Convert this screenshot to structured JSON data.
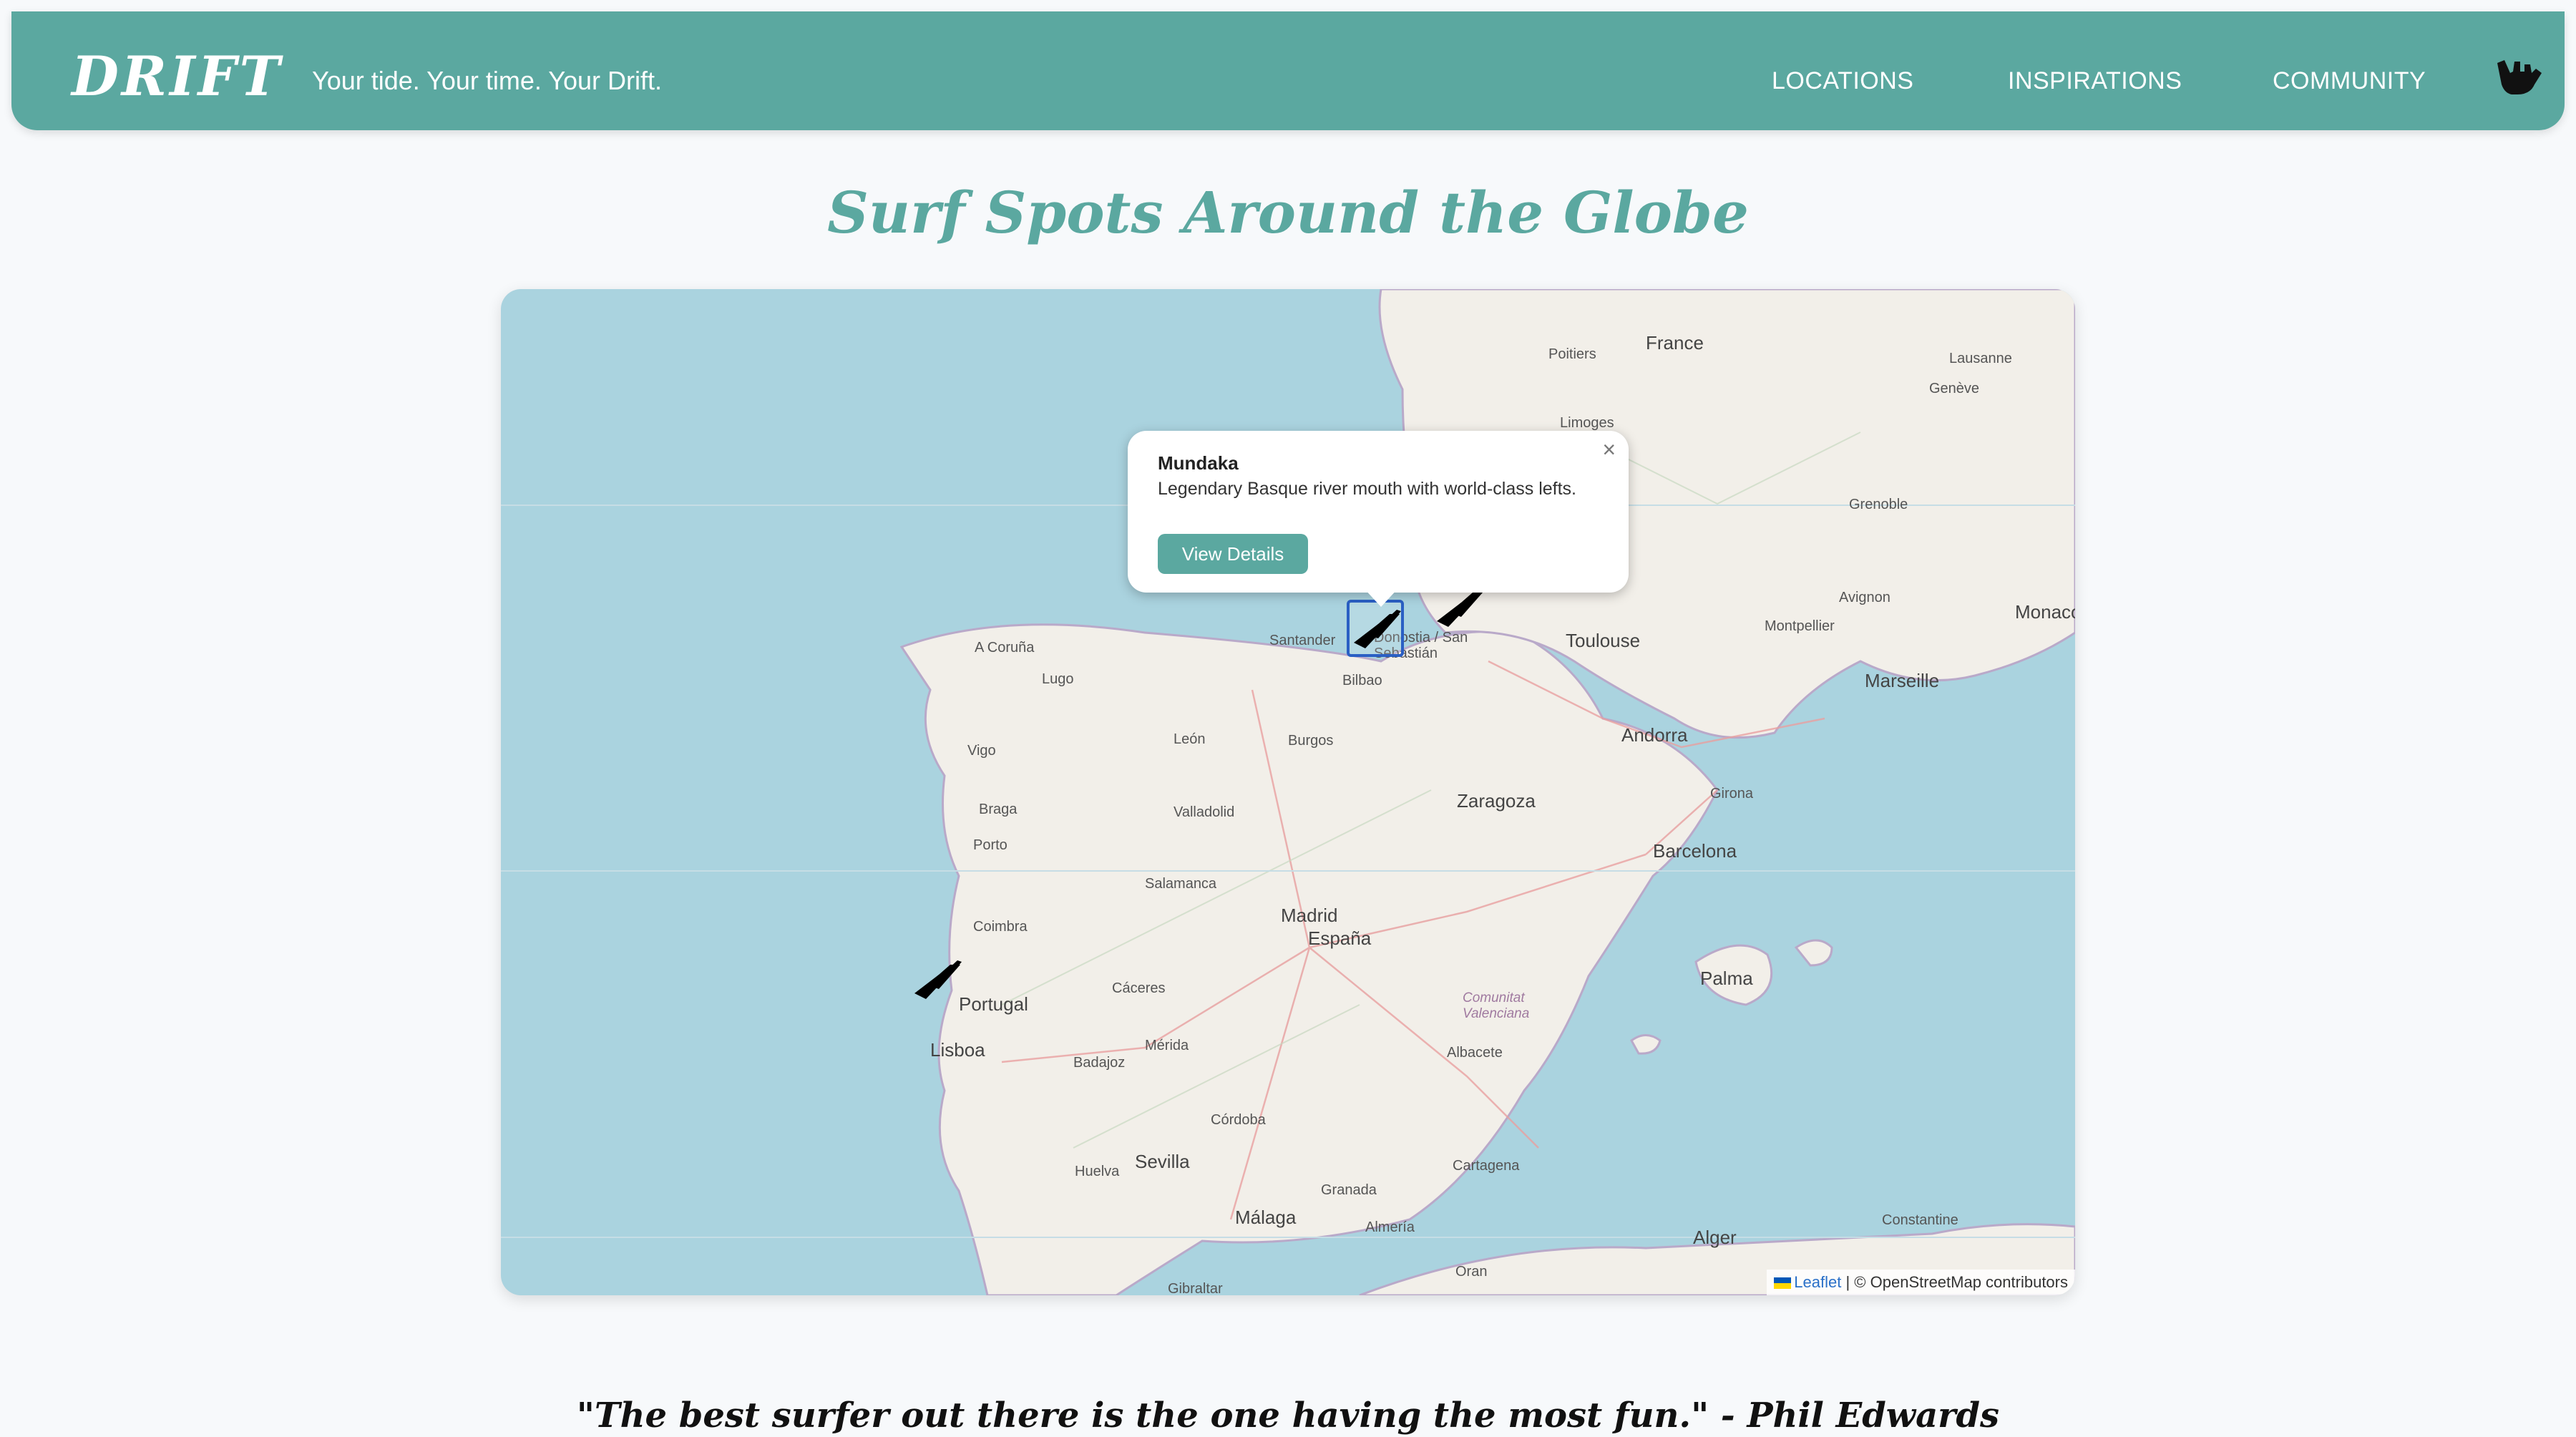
{
  "header": {
    "logo": "DRIFT",
    "tagline": "Your tide. Your time. Your Drift.",
    "nav": [
      "LOCATIONS",
      "INSPIRATIONS",
      "COMMUNITY"
    ],
    "icon": "shaka-hand-icon"
  },
  "page_title": "Surf Spots Around the Globe",
  "map": {
    "labels": {
      "country_france": "France",
      "country_spain": "España",
      "country_portugal": "Portugal",
      "madrid": "Madrid",
      "lisboa": "Lisboa",
      "toulouse": "Toulouse",
      "zaragoza": "Zaragoza",
      "barcelona": "Barcelona",
      "sevilla": "Sevilla",
      "malaga": "Málaga",
      "marseille": "Marseille",
      "andorra": "Andorra",
      "palma": "Palma",
      "bilbao": "Bilbao",
      "santander": "Santander",
      "donostia": "Donostia / San Sebastián",
      "a_coruna": "A Coruña",
      "porto": "Porto",
      "coimbra": "Coimbra",
      "valladolid": "Valladolid",
      "salamanca": "Salamanca",
      "granada": "Granada",
      "cordoba": "Córdoba",
      "valencia_region": "Comunitat Valenciana",
      "alger": "Alger",
      "oran": "Oran",
      "gibraltar": "Gibraltar",
      "montpellier": "Montpellier",
      "limoges": "Limoges",
      "poitiers": "Poitiers",
      "lausanne": "Lausanne",
      "geneve": "Genève",
      "grenoble": "Grenoble",
      "avignon": "Avignon",
      "monaco": "Monaco",
      "leon": "León",
      "burgos": "Burgos",
      "caceres": "Cáceres",
      "albacete": "Albacete",
      "cartagena": "Cartagena",
      "almeria": "Almería",
      "huelva": "Huelva",
      "badajoz": "Badajoz",
      "merida": "Mérida",
      "vigo": "Vigo",
      "braga": "Braga",
      "lugo": "Lugo",
      "girona": "Girona",
      "constantine": "Constantine"
    },
    "popup": {
      "title": "Mundaka",
      "description": "Legendary Basque river mouth with world-class lefts.",
      "button": "View Details",
      "close": "×"
    },
    "attribution": {
      "leaflet": "Leaflet",
      "rest": "| © OpenStreetMap contributors"
    },
    "markers": [
      "surfboard-icon",
      "surfboard-icon",
      "surfboard-icon"
    ]
  },
  "quote": "\"The best surfer out there is the one having the most fun.\" - Phil Edwards"
}
